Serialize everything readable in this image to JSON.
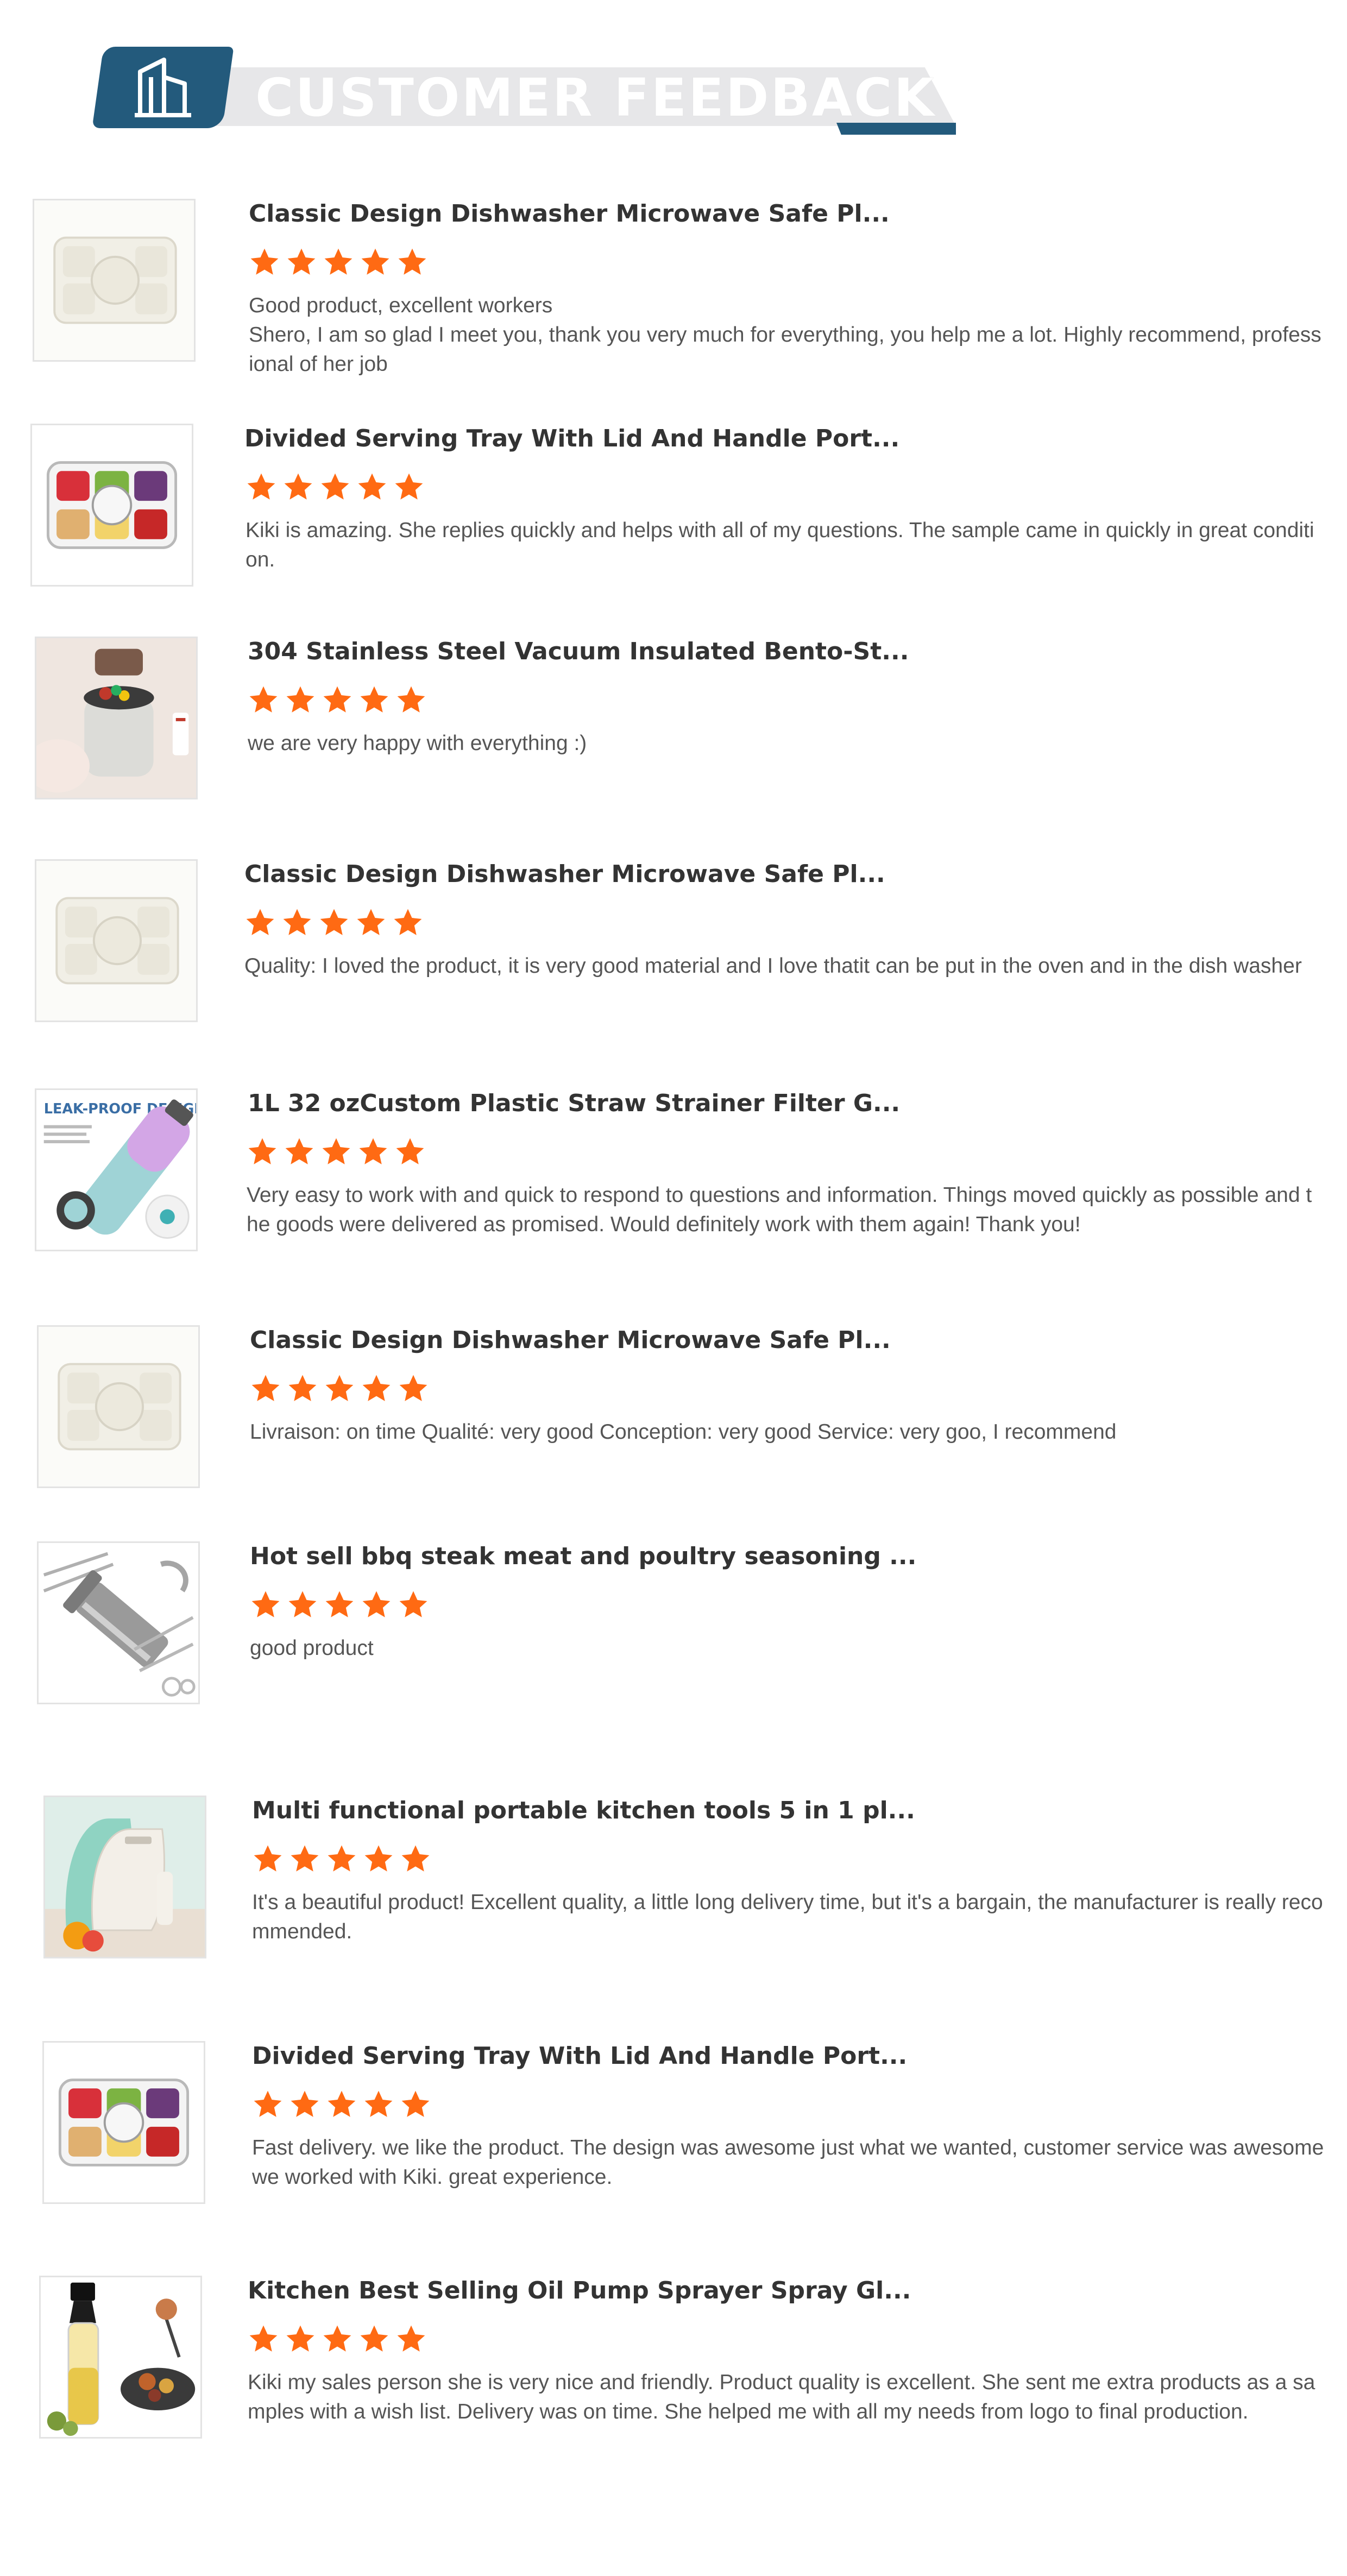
{
  "header": {
    "title": "CUSTOMER FEEDBACK",
    "icon": "building-icon",
    "brand_color": "#235a7c"
  },
  "rating": {
    "max": 5,
    "star_color": "#ff6a13"
  },
  "reviews": [
    {
      "title": "Classic Design Dishwasher Microwave Safe Pl...",
      "stars": 5,
      "text": "Good product, excellent workers\nShero, I am so glad I meet you, thank you very much for everything, you help me a lot. Highly recommend, professional of her job",
      "image": "white-divided-food-container"
    },
    {
      "title": "Divided Serving Tray With Lid And Handle Port...",
      "stars": 5,
      "text": "Kiki is amazing. She replies quickly and helps with all of my questions. The sample came in quickly in great condition.",
      "image": "divided-serving-tray-with-snacks"
    },
    {
      "title": "304 Stainless Steel Vacuum Insulated Bento-St...",
      "stars": 5,
      "text": "we are very happy with everything :)",
      "image": "insulated-food-jar"
    },
    {
      "title": "Classic Design Dishwasher Microwave Safe Pl...",
      "stars": 5,
      "text": "Quality:  I loved the product, it is very good material and I love thatit can be put in the oven and in the dish washer",
      "image": "white-divided-food-container"
    },
    {
      "title": "1L 32 ozCustom Plastic Straw Strainer Filter G...",
      "stars": 5,
      "text": "Very easy to work with and quick to respond to questions and information. Things moved quickly as possible and the goods were delivered as promised. Would definitely work with them again! Thank you!",
      "image": "leak-proof-water-bottle",
      "image_text": "LEAK-PROOF DESIGN"
    },
    {
      "title": "Classic Design Dishwasher Microwave Safe Pl...",
      "stars": 5,
      "text": "Livraison: on time Qualité:  very good Conception:  very good Service:  very goo, I recommend",
      "image": "white-divided-food-container"
    },
    {
      "title": "Hot sell bbq steak meat and poultry seasoning ...",
      "stars": 5,
      "text": "good product",
      "image": "meat-injector-kit"
    },
    {
      "title": "Multi functional portable kitchen tools 5 in 1 pl...",
      "stars": 5,
      "text": "It's a beautiful product! Excellent quality, a little long delivery time, but it's a bargain, the manufacturer is really recommended.",
      "image": "kitchen-tools-set"
    },
    {
      "title": "Divided Serving Tray With Lid And Handle Port...",
      "stars": 5,
      "text": "Fast delivery. we like the product. The design was awesome just what we wanted, customer service was awesome we worked with Kiki. great experience.",
      "image": "divided-serving-tray-with-snacks"
    },
    {
      "title": "Kitchen Best Selling Oil Pump Sprayer Spray Gl...",
      "stars": 5,
      "text": "Kiki my sales person she is very nice and friendly. Product quality is excellent.  She sent me extra products as a samples with a wish list. Delivery was on time. She helped me with all my needs from logo  to final production.",
      "image": "oil-sprayer-bottle"
    }
  ]
}
